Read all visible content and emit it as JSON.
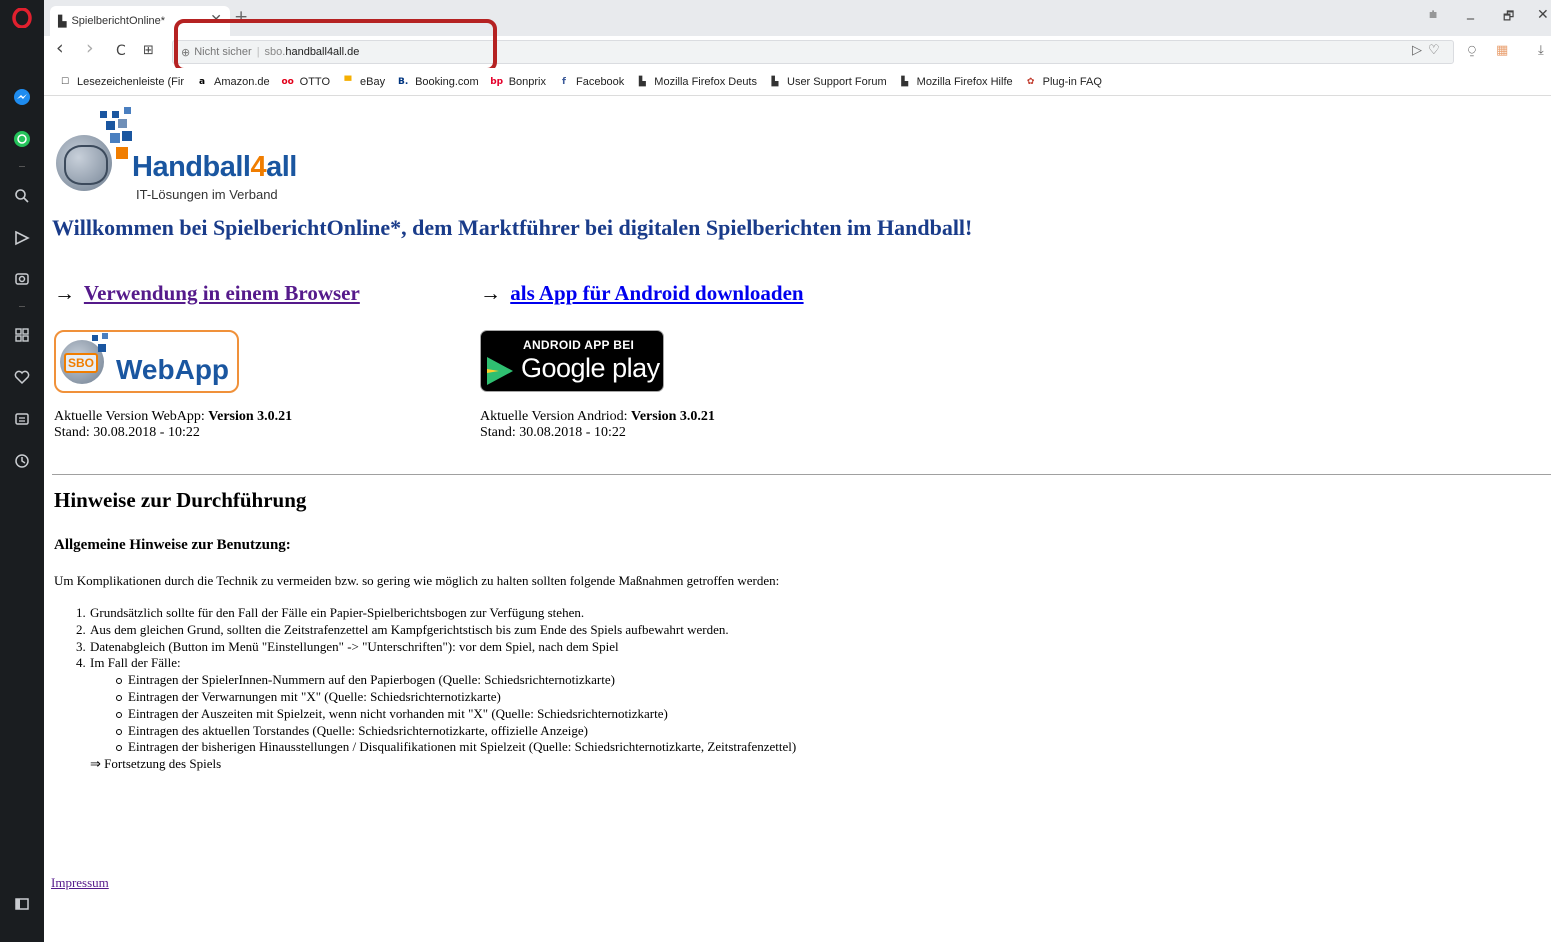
{
  "browser": {
    "tab": {
      "title": "SpielberichtOnline*",
      "close": "✕"
    },
    "new_tab": "+",
    "window_controls": {
      "menu": "⩧",
      "minimize": "_",
      "restore": "🗗",
      "close": "✕"
    },
    "nav": {
      "back": "‹",
      "forward": "›",
      "reload": "C",
      "speed_dial": "⊞"
    },
    "address": {
      "security": "Nicht sicher",
      "subdomain": "sbo.",
      "host": "handball4all.de"
    },
    "bookmarks": [
      {
        "label": "Lesezeichenleiste (Fir",
        "icon": "folder-icon",
        "glyph": "☐",
        "color": "#444444"
      },
      {
        "label": "Amazon.de",
        "icon": "amazon-icon",
        "glyph": "a",
        "color": "#000000"
      },
      {
        "label": "OTTO",
        "icon": "otto-icon",
        "glyph": "oo",
        "color": "#e2001a"
      },
      {
        "label": "eBay",
        "icon": "ebay-icon",
        "glyph": "▀",
        "color": "#f5af02"
      },
      {
        "label": "Booking.com",
        "icon": "booking-icon",
        "glyph": "B.",
        "color": "#003580"
      },
      {
        "label": "Bonprix",
        "icon": "bonprix-icon",
        "glyph": "bp",
        "color": "#e4002b"
      },
      {
        "label": "Facebook",
        "icon": "facebook-icon",
        "glyph": "f",
        "color": "#3b5998"
      },
      {
        "label": "Mozilla Firefox Deuts",
        "icon": "page-icon",
        "glyph": "▙",
        "color": "#333333"
      },
      {
        "label": "User Support Forum",
        "icon": "page-icon",
        "glyph": "▙",
        "color": "#333333"
      },
      {
        "label": "Mozilla Firefox Hilfe",
        "icon": "page-icon",
        "glyph": "▙",
        "color": "#333333"
      },
      {
        "label": "Plug-in FAQ",
        "icon": "plugin-icon",
        "glyph": "✿",
        "color": "#c0392b"
      }
    ]
  },
  "page": {
    "logo": {
      "brand_a": "Handball",
      "brand_b": "4",
      "brand_c": "all",
      "tagline": "IT-Lösungen im Verband"
    },
    "welcome": "Willkommen bei SpielberichtOnline*, dem Marktführer bei digitalen Spielberichten im Handball!",
    "browser_link": {
      "arrow": "→",
      "label": "Verwendung in einem Browser"
    },
    "android_link": {
      "arrow": "→",
      "label": "als App für Android downloaden"
    },
    "webapp_button": {
      "sbo": "SBO",
      "label": "WebApp"
    },
    "gplay_button": {
      "small": "ANDROID APP BEI",
      "big": "Google play"
    },
    "webapp_version": {
      "prefix": "Aktuelle Version WebApp: ",
      "version": "Version 3.0.21",
      "date": "Stand: 30.08.2018 - 10:22"
    },
    "android_version": {
      "prefix": "Aktuelle Version Andriod: ",
      "version": "Version 3.0.21",
      "date": "Stand: 30.08.2018 - 10:22"
    },
    "section_title": "Hinweise zur Durchführung",
    "subsection_title": "Allgemeine Hinweise zur Benutzung:",
    "intro": "Um Komplikationen durch die Technik zu vermeiden bzw. so gering wie möglich zu halten sollten folgende Maßnahmen getroffen werden:",
    "list": [
      {
        "n": "1.",
        "text": "Grundsätzlich sollte für den Fall der Fälle ein Papier-Spielberichtsbogen zur Verfügung stehen."
      },
      {
        "n": "2.",
        "text": "Aus dem gleichen Grund, sollten die Zeitstrafenzettel am Kampfgerichtstisch bis zum Ende des Spiels aufbewahrt werden."
      },
      {
        "n": "3.",
        "text": "Datenabgleich (Button im Menü \"Einstellungen\" -> \"Unterschriften\"): vor dem Spiel, nach dem Spiel"
      },
      {
        "n": "4.",
        "text": "Im Fall der Fälle:"
      }
    ],
    "sublist": [
      "Eintragen der SpielerInnen-Nummern auf den Papierbogen (Quelle: Schiedsrichternotizkarte)",
      "Eintragen der Verwarnungen mit \"X\" (Quelle: Schiedsrichternotizkarte)",
      "Eintragen der Auszeiten mit Spielzeit, wenn nicht vorhanden mit \"X\" (Quelle: Schiedsrichternotizkarte)",
      "Eintragen des aktuellen Torstandes (Quelle: Schiedsrichternotizkarte, offizielle Anzeige)",
      "Eintragen der bisherigen Hinausstellungen / Disqualifikationen mit Spielzeit (Quelle: Schiedsrichternotizkarte, Zeitstrafenzettel)"
    ],
    "continuation": "⇒ Fortsetzung des Spiels",
    "impressum": "Impressum"
  },
  "colors": {
    "highlight": "#b52222",
    "brand_blue": "#1a56a0",
    "brand_orange": "#f07d00",
    "sidebar": "#1a1d20"
  }
}
